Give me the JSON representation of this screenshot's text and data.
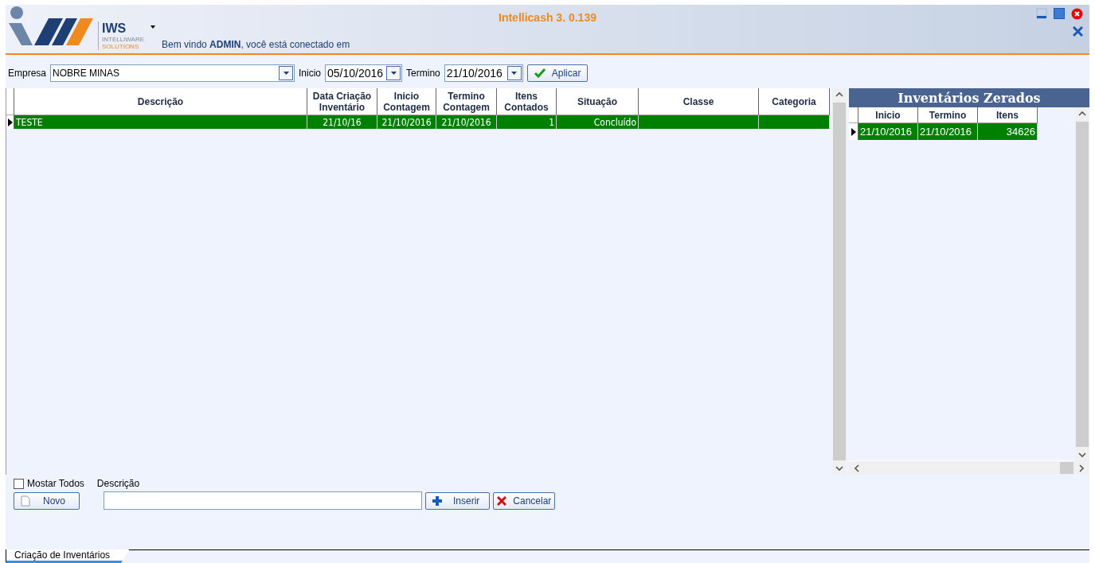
{
  "window": {
    "title": "Intellicash 3. 0.139"
  },
  "logo": {
    "name": "IWS",
    "line_1": "INTELLIWARE",
    "line_2": "SOLUTIONS"
  },
  "welcome": "Bem vindo **ADMIN**, você está conectado em",
  "filters": {
    "empresa_label": "Empresa",
    "empresa": "NOBRE MINAS",
    "inicio_label": "Inicio",
    "inicio": "05/10/2016",
    "termino_label": "Termino",
    "termino": "21/10/2016",
    "apply": "Aplicar"
  },
  "table": {
    "columns": [
      "Descrição",
      "Data Criação Inventário",
      "Inicio Contagem",
      "Termino Contagem",
      "Itens Contados",
      "Situação",
      "Classe",
      "Categoria"
    ],
    "rows": [
      {
        "selected": true,
        "cells": [
          "TESTE",
          "21/10/16",
          "21/10/2016",
          "21/10/2016",
          "1",
          "Concluído",
          "",
          ""
        ]
      }
    ]
  },
  "zerados": {
    "title": "Inventários Zerados",
    "columns": [
      "Inicio",
      "Termino",
      "Itens"
    ],
    "rows": [
      {
        "selected": true,
        "cells": [
          "21/10/2016",
          "21/10/2016",
          "34626"
        ]
      }
    ]
  },
  "bottom": {
    "show_all": {
      "label": "Mostar Todos",
      "checked": false
    },
    "description_label": "Descrição",
    "new": "Novo",
    "insert": "Inserir",
    "cancel": "Cancelar"
  },
  "tabs": [
    {
      "label": "Criação de Inventários",
      "selected": true
    }
  ]
}
